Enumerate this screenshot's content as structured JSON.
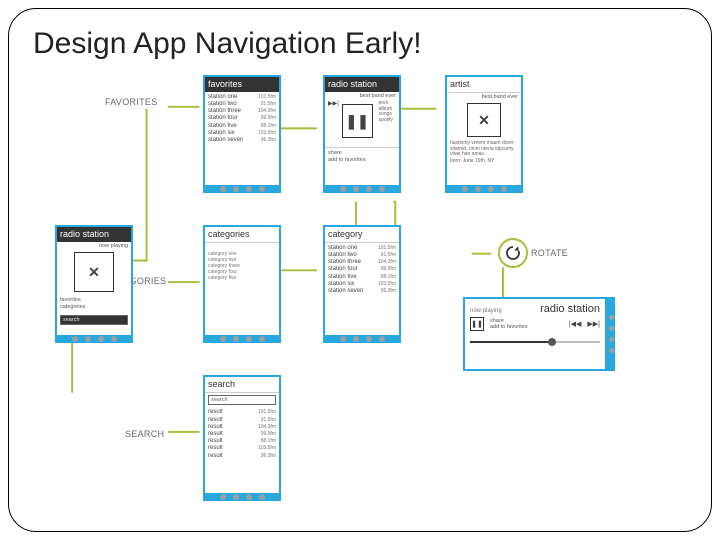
{
  "title": "Design App Navigation Early!",
  "labels": {
    "favorites": "FAVORITES",
    "categories": "CATEGORIES",
    "search": "SEARCH",
    "rotate": "ROTATE"
  },
  "screens": {
    "favorites": {
      "header": "favorites",
      "items": [
        {
          "name": "station one",
          "freq": "101.5fm"
        },
        {
          "name": "station two",
          "freq": "91.5fm"
        },
        {
          "name": "station three",
          "freq": "104.3fm"
        },
        {
          "name": "station four",
          "freq": "99.5fm"
        },
        {
          "name": "station five",
          "freq": "88.1fm"
        },
        {
          "name": "station six",
          "freq": "103.5fm"
        },
        {
          "name": "station seven",
          "freq": "96.3fm"
        }
      ]
    },
    "radio": {
      "header": "radio station",
      "sub": "best band ever",
      "tracklinks": [
        "prev",
        "album",
        "songs",
        "spotify"
      ],
      "links": [
        "share",
        "add to favorites"
      ]
    },
    "artist": {
      "header": "artist",
      "sub": "best band ever",
      "bio": "hastinmy vreem maum dorer sitamet, onim nterla idpcumy vitae han amas.",
      "bio2": "born: June 19th, NY"
    },
    "nowplaying": {
      "header": "radio station",
      "sub": "now playing",
      "links": [
        "favorites",
        "categories"
      ],
      "search": "search"
    },
    "categories": {
      "header": "categories",
      "items": [
        "category one",
        "category two",
        "category three",
        "category four",
        "category five"
      ]
    },
    "category": {
      "header": "category",
      "items": [
        {
          "name": "station one",
          "freq": "101.5fm"
        },
        {
          "name": "station two",
          "freq": "91.5fm"
        },
        {
          "name": "station three",
          "freq": "104.3fm"
        },
        {
          "name": "station four",
          "freq": "99.5fm"
        },
        {
          "name": "station five",
          "freq": "88.1fm"
        },
        {
          "name": "station six",
          "freq": "103.5fm"
        },
        {
          "name": "station seven",
          "freq": "96.3fm"
        }
      ]
    },
    "search": {
      "header": "search",
      "placeholder": "search",
      "items": [
        {
          "name": "result",
          "freq": "101.5fm"
        },
        {
          "name": "result",
          "freq": "91.5fm"
        },
        {
          "name": "result",
          "freq": "104.3fm"
        },
        {
          "name": "result",
          "freq": "99.5fm"
        },
        {
          "name": "result",
          "freq": "88.1fm"
        },
        {
          "name": "result",
          "freq": "103.5fm"
        },
        {
          "name": "result",
          "freq": "96.3fm"
        }
      ]
    },
    "landscape": {
      "nowplaying": "now playing",
      "name": "radio station",
      "links": [
        "share",
        "add to favorites"
      ],
      "prev": "|◀◀",
      "next": "▶▶|"
    }
  },
  "icons": {
    "pause": "❚❚",
    "close": "✕",
    "refresh": "↻"
  }
}
